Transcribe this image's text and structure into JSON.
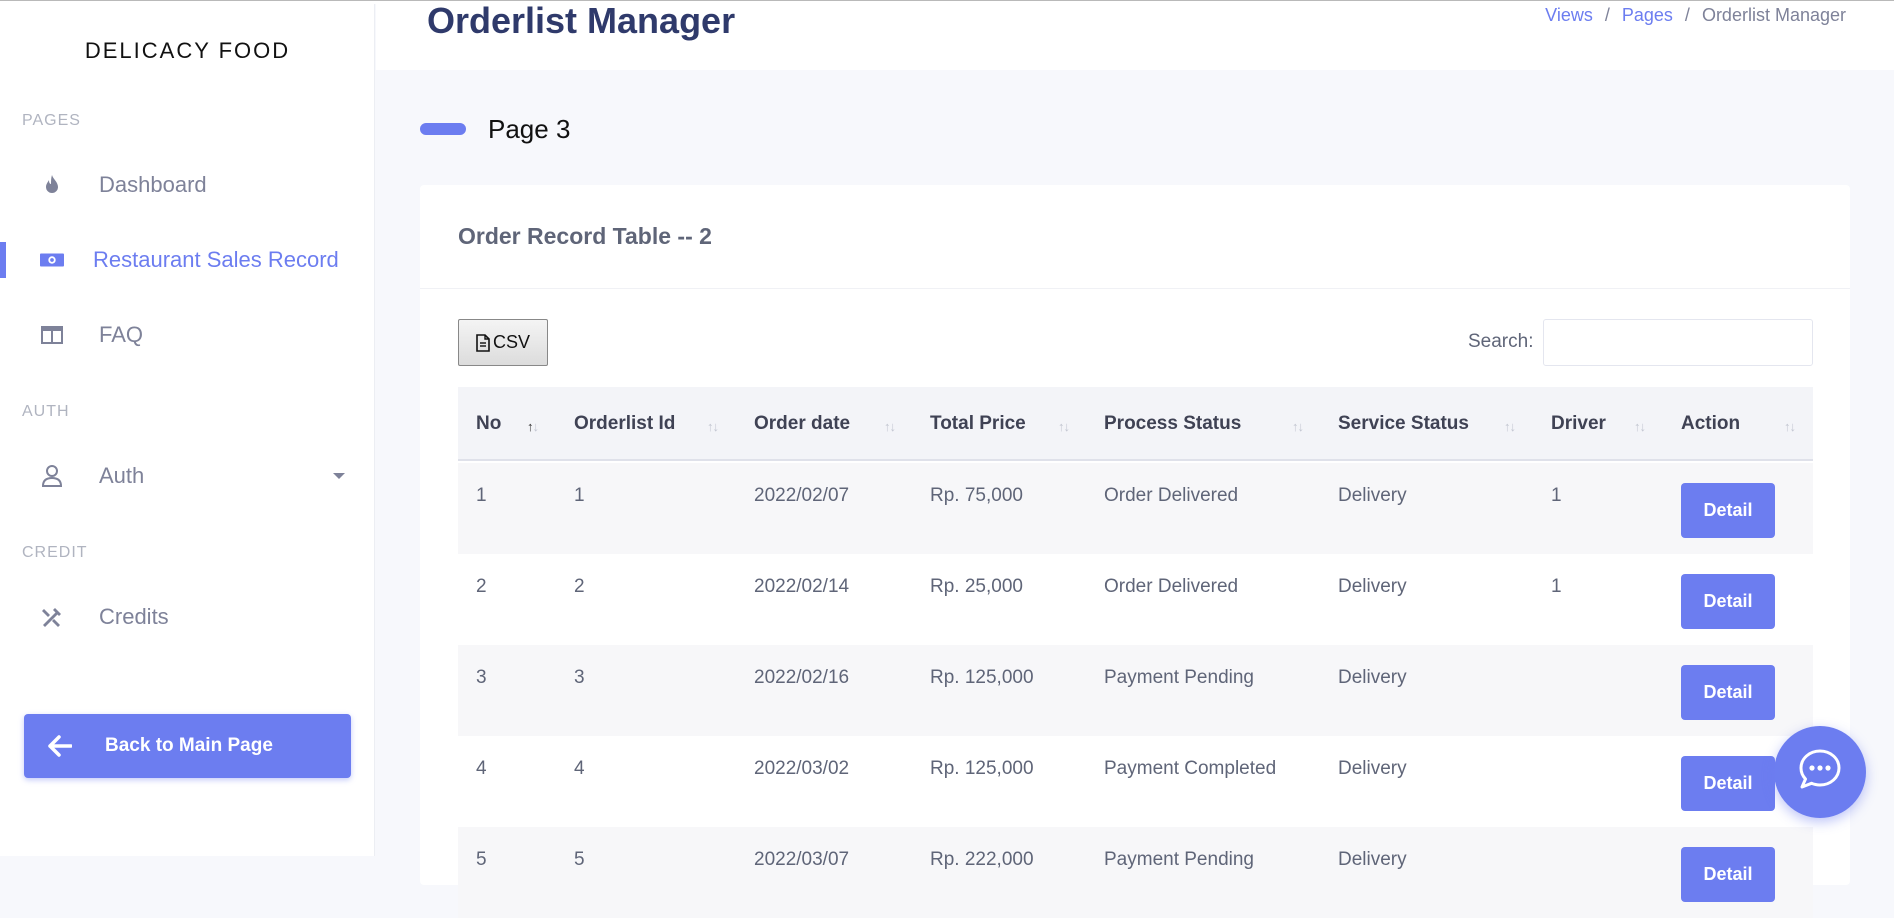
{
  "brand": "DELICACY FOOD",
  "sidebar": {
    "sections": {
      "pages": "PAGES",
      "auth": "AUTH",
      "credit": "CREDIT"
    },
    "items": {
      "dashboard": "Dashboard",
      "sales": "Restaurant Sales Record",
      "faq": "FAQ",
      "auth": "Auth",
      "credits": "Credits"
    },
    "active": "Restaurant Sales Record",
    "back_button": "Back to Main Page"
  },
  "header": {
    "title": "Orderlist Manager",
    "breadcrumb": [
      "Views",
      "Pages",
      "Orderlist Manager"
    ]
  },
  "subheading": "Page 3",
  "card": {
    "title": "Order Record Table -- 2",
    "csv_label": "CSV",
    "search_label": "Search:",
    "search_value": ""
  },
  "table": {
    "columns": [
      "No",
      "Orderlist Id",
      "Order date",
      "Total Price",
      "Process Status",
      "Service Status",
      "Driver",
      "Action"
    ],
    "sort_icon": "↑↓",
    "rows": [
      {
        "no": "1",
        "id": "1",
        "date": "2022/02/07",
        "price": "Rp. 75,000",
        "process": "Order Delivered",
        "service": "Delivery",
        "driver": "1",
        "action": "Detail"
      },
      {
        "no": "2",
        "id": "2",
        "date": "2022/02/14",
        "price": "Rp. 25,000",
        "process": "Order Delivered",
        "service": "Delivery",
        "driver": "1",
        "action": "Detail"
      },
      {
        "no": "3",
        "id": "3",
        "date": "2022/02/16",
        "price": "Rp. 125,000",
        "process": "Payment Pending",
        "service": "Delivery",
        "driver": "",
        "action": "Detail"
      },
      {
        "no": "4",
        "id": "4",
        "date": "2022/03/02",
        "price": "Rp. 125,000",
        "process": "Payment Completed",
        "service": "Delivery",
        "driver": "",
        "action": "Detail"
      },
      {
        "no": "5",
        "id": "5",
        "date": "2022/03/07",
        "price": "Rp. 222,000",
        "process": "Payment Pending",
        "service": "Delivery",
        "driver": "",
        "action": "Detail"
      }
    ]
  },
  "icons": {
    "dashboard": "fire-icon",
    "sales": "money-icon",
    "faq": "columns-icon",
    "auth": "user-icon",
    "credits": "tools-icon",
    "back": "arrow-left-icon",
    "csv": "file-icon",
    "chat": "chat-icon"
  },
  "colors": {
    "accent": "#6c7df0",
    "title": "#2f3a6b"
  }
}
